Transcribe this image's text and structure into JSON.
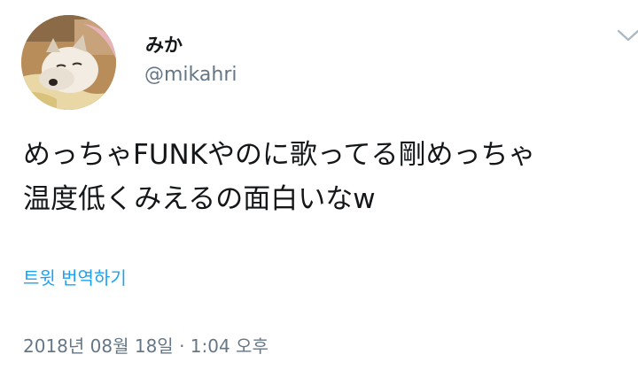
{
  "tweet": {
    "author": {
      "display_name": "みか",
      "handle": "@mikahri",
      "avatar_icon": "avatar-dog-photo"
    },
    "text_lines": [
      "めっちゃFUNKやのに歌ってる剛めっちゃ",
      "温度低くみえるの面白いなw"
    ],
    "translate_label": "트윗 번역하기",
    "timestamp": "2018년 08월 18일 · 1:04 오후",
    "menu_icon": "chevron-down-icon"
  },
  "colors": {
    "primary_text": "#14171a",
    "secondary_text": "#657786",
    "link": "#1da1f2",
    "background": "#ffffff"
  }
}
